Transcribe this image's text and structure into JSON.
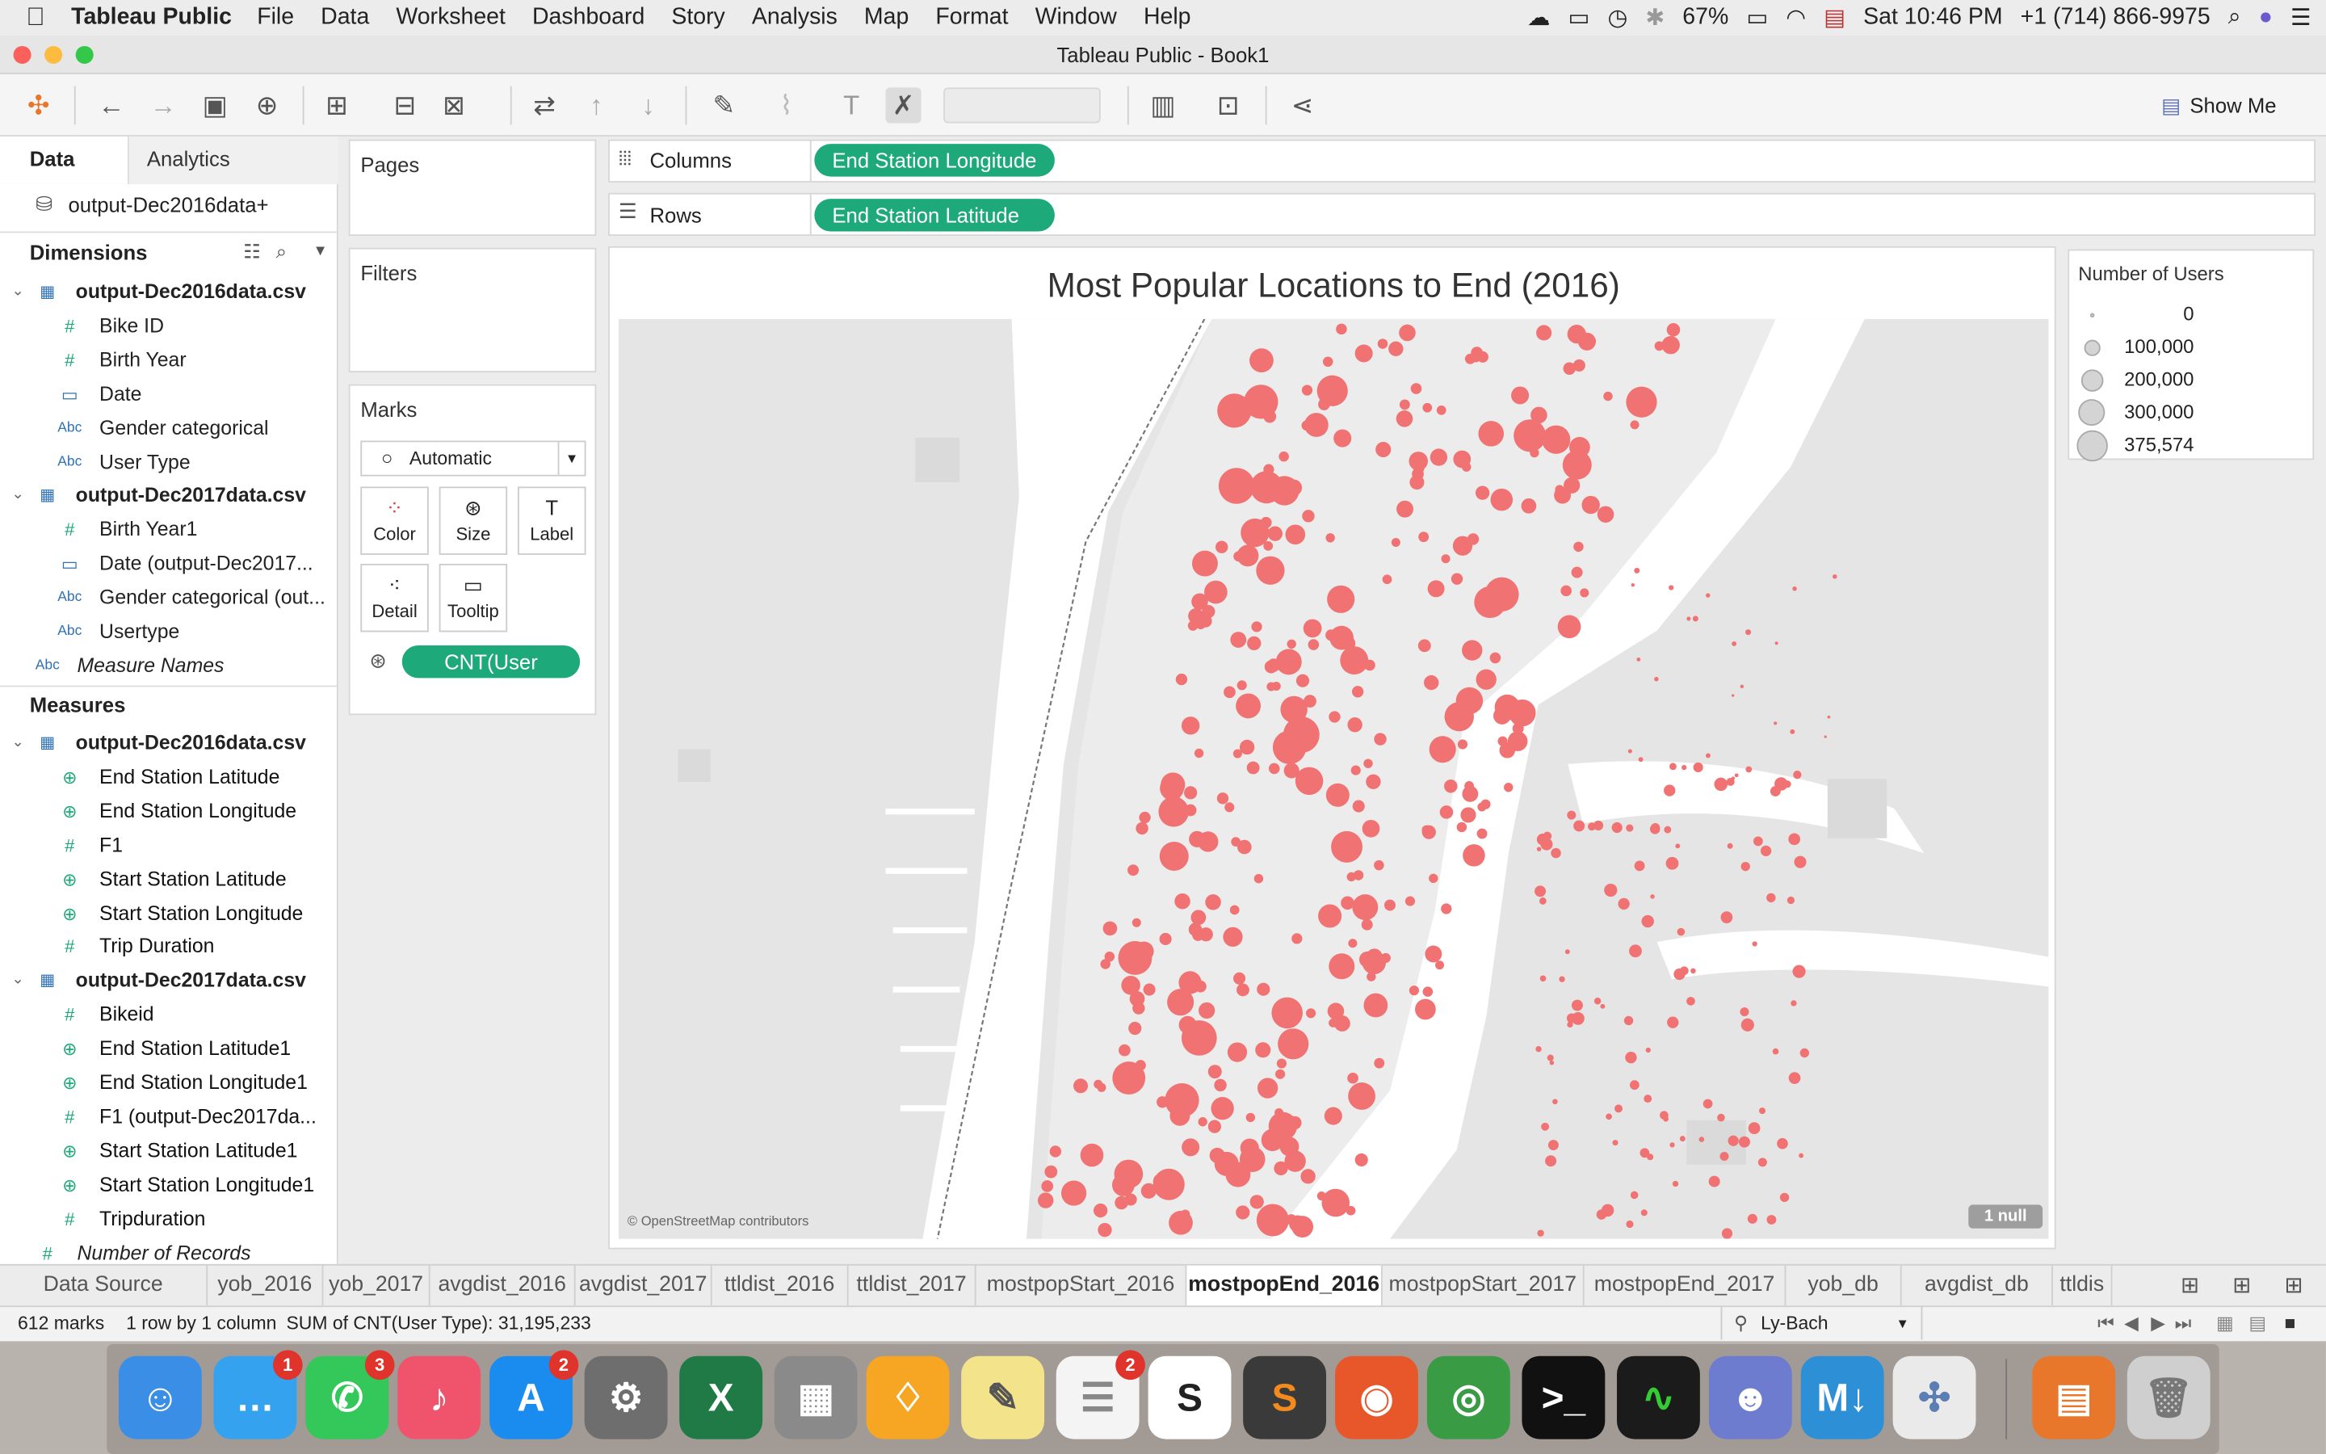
{
  "menubar": {
    "apple": "",
    "app": "Tableau Public",
    "items": [
      "File",
      "Data",
      "Worksheet",
      "Dashboard",
      "Story",
      "Analysis",
      "Map",
      "Format",
      "Window",
      "Help"
    ],
    "battery": "67%",
    "clock": "Sat 10:46 PM",
    "phone": "+1 (714) 866-9975"
  },
  "window": {
    "title": "Tableau Public - Book1"
  },
  "toolbar": {
    "show_me": "Show Me"
  },
  "side": {
    "tab_data": "Data",
    "tab_analytics": "Analytics",
    "datasource": "output-Dec2016data+",
    "dimensions_label": "Dimensions",
    "measures_label": "Measures",
    "dims": [
      {
        "label": "output-Dec2016data.csv",
        "type": "table",
        "level": 0
      },
      {
        "label": "Bike ID",
        "type": "#",
        "level": 1
      },
      {
        "label": "Birth Year",
        "type": "#",
        "level": 1
      },
      {
        "label": "Date",
        "type": "date",
        "level": 1
      },
      {
        "label": "Gender categorical",
        "type": "Abc",
        "level": 1
      },
      {
        "label": "User Type",
        "type": "Abc",
        "level": 1
      },
      {
        "label": "output-Dec2017data.csv",
        "type": "table",
        "level": 0
      },
      {
        "label": "Birth Year1",
        "type": "#",
        "level": 1
      },
      {
        "label": "Date (output-Dec2017...",
        "type": "date",
        "level": 1
      },
      {
        "label": "Gender categorical (out...",
        "type": "Abc",
        "level": 1
      },
      {
        "label": "Usertype",
        "type": "Abc",
        "level": 1
      },
      {
        "label": "Measure Names",
        "type": "Abc",
        "level": 2
      }
    ],
    "meas": [
      {
        "label": "output-Dec2016data.csv",
        "type": "table",
        "level": 0
      },
      {
        "label": "End Station Latitude",
        "type": "geo",
        "level": 1
      },
      {
        "label": "End Station Longitude",
        "type": "geo",
        "level": 1
      },
      {
        "label": "F1",
        "type": "#",
        "level": 1
      },
      {
        "label": "Start Station Latitude",
        "type": "geo",
        "level": 1
      },
      {
        "label": "Start Station Longitude",
        "type": "geo",
        "level": 1
      },
      {
        "label": "Trip Duration",
        "type": "#",
        "level": 1
      },
      {
        "label": "output-Dec2017data.csv",
        "type": "table",
        "level": 0
      },
      {
        "label": "Bikeid",
        "type": "#",
        "level": 1
      },
      {
        "label": "End Station Latitude1",
        "type": "geo",
        "level": 1
      },
      {
        "label": "End Station Longitude1",
        "type": "geo",
        "level": 1
      },
      {
        "label": "F1 (output-Dec2017da...",
        "type": "#",
        "level": 1
      },
      {
        "label": "Start Station Latitude1",
        "type": "geo",
        "level": 1
      },
      {
        "label": "Start Station Longitude1",
        "type": "geo",
        "level": 1
      },
      {
        "label": "Tripduration",
        "type": "#",
        "level": 1
      },
      {
        "label": "Number of Records",
        "type": "#",
        "level": 2
      }
    ]
  },
  "shelves": {
    "pages": "Pages",
    "filters": "Filters",
    "marks": "Marks",
    "marks_type": "Automatic",
    "mark_buttons": [
      "Color",
      "Size",
      "Label",
      "Detail",
      "Tooltip"
    ],
    "size_pill": "CNT(User Type)",
    "columns_label": "Columns",
    "rows_label": "Rows",
    "columns_pill": "End Station Longitude",
    "rows_pill": "End Station Latitude"
  },
  "sheet": {
    "title": "Most Popular Locations to End (2016)",
    "attribution": "© OpenStreetMap contributors",
    "null_badge": "1 null"
  },
  "legend": {
    "title": "Number of Users",
    "items": [
      "0",
      "100,000",
      "200,000",
      "300,000",
      "375,574"
    ]
  },
  "tabs": [
    "Data Source",
    "yob_2016",
    "yob_2017",
    "avgdist_2016",
    "avgdist_2017",
    "ttldist_2016",
    "ttldist_2017",
    "mostpopStart_2016",
    "mostpopEnd_2016",
    "mostpopStart_2017",
    "mostpopEnd_2017",
    "yob_db",
    "avgdist_db",
    "ttldis"
  ],
  "active_tab": "mostpopEnd_2016",
  "status": {
    "marks": "612 marks",
    "dims": "1 row by 1 column",
    "sum": "SUM of CNT(User Type): 31,195,233",
    "user": "Ly-Bach"
  },
  "dock": {
    "badges": {
      "messages": "1",
      "facetime": "3",
      "appstore": "2",
      "reminders": "2"
    }
  },
  "colors": {
    "accent": "#1ea97a",
    "mark": "#f07272",
    "map_bg": "#e5e5e5"
  }
}
